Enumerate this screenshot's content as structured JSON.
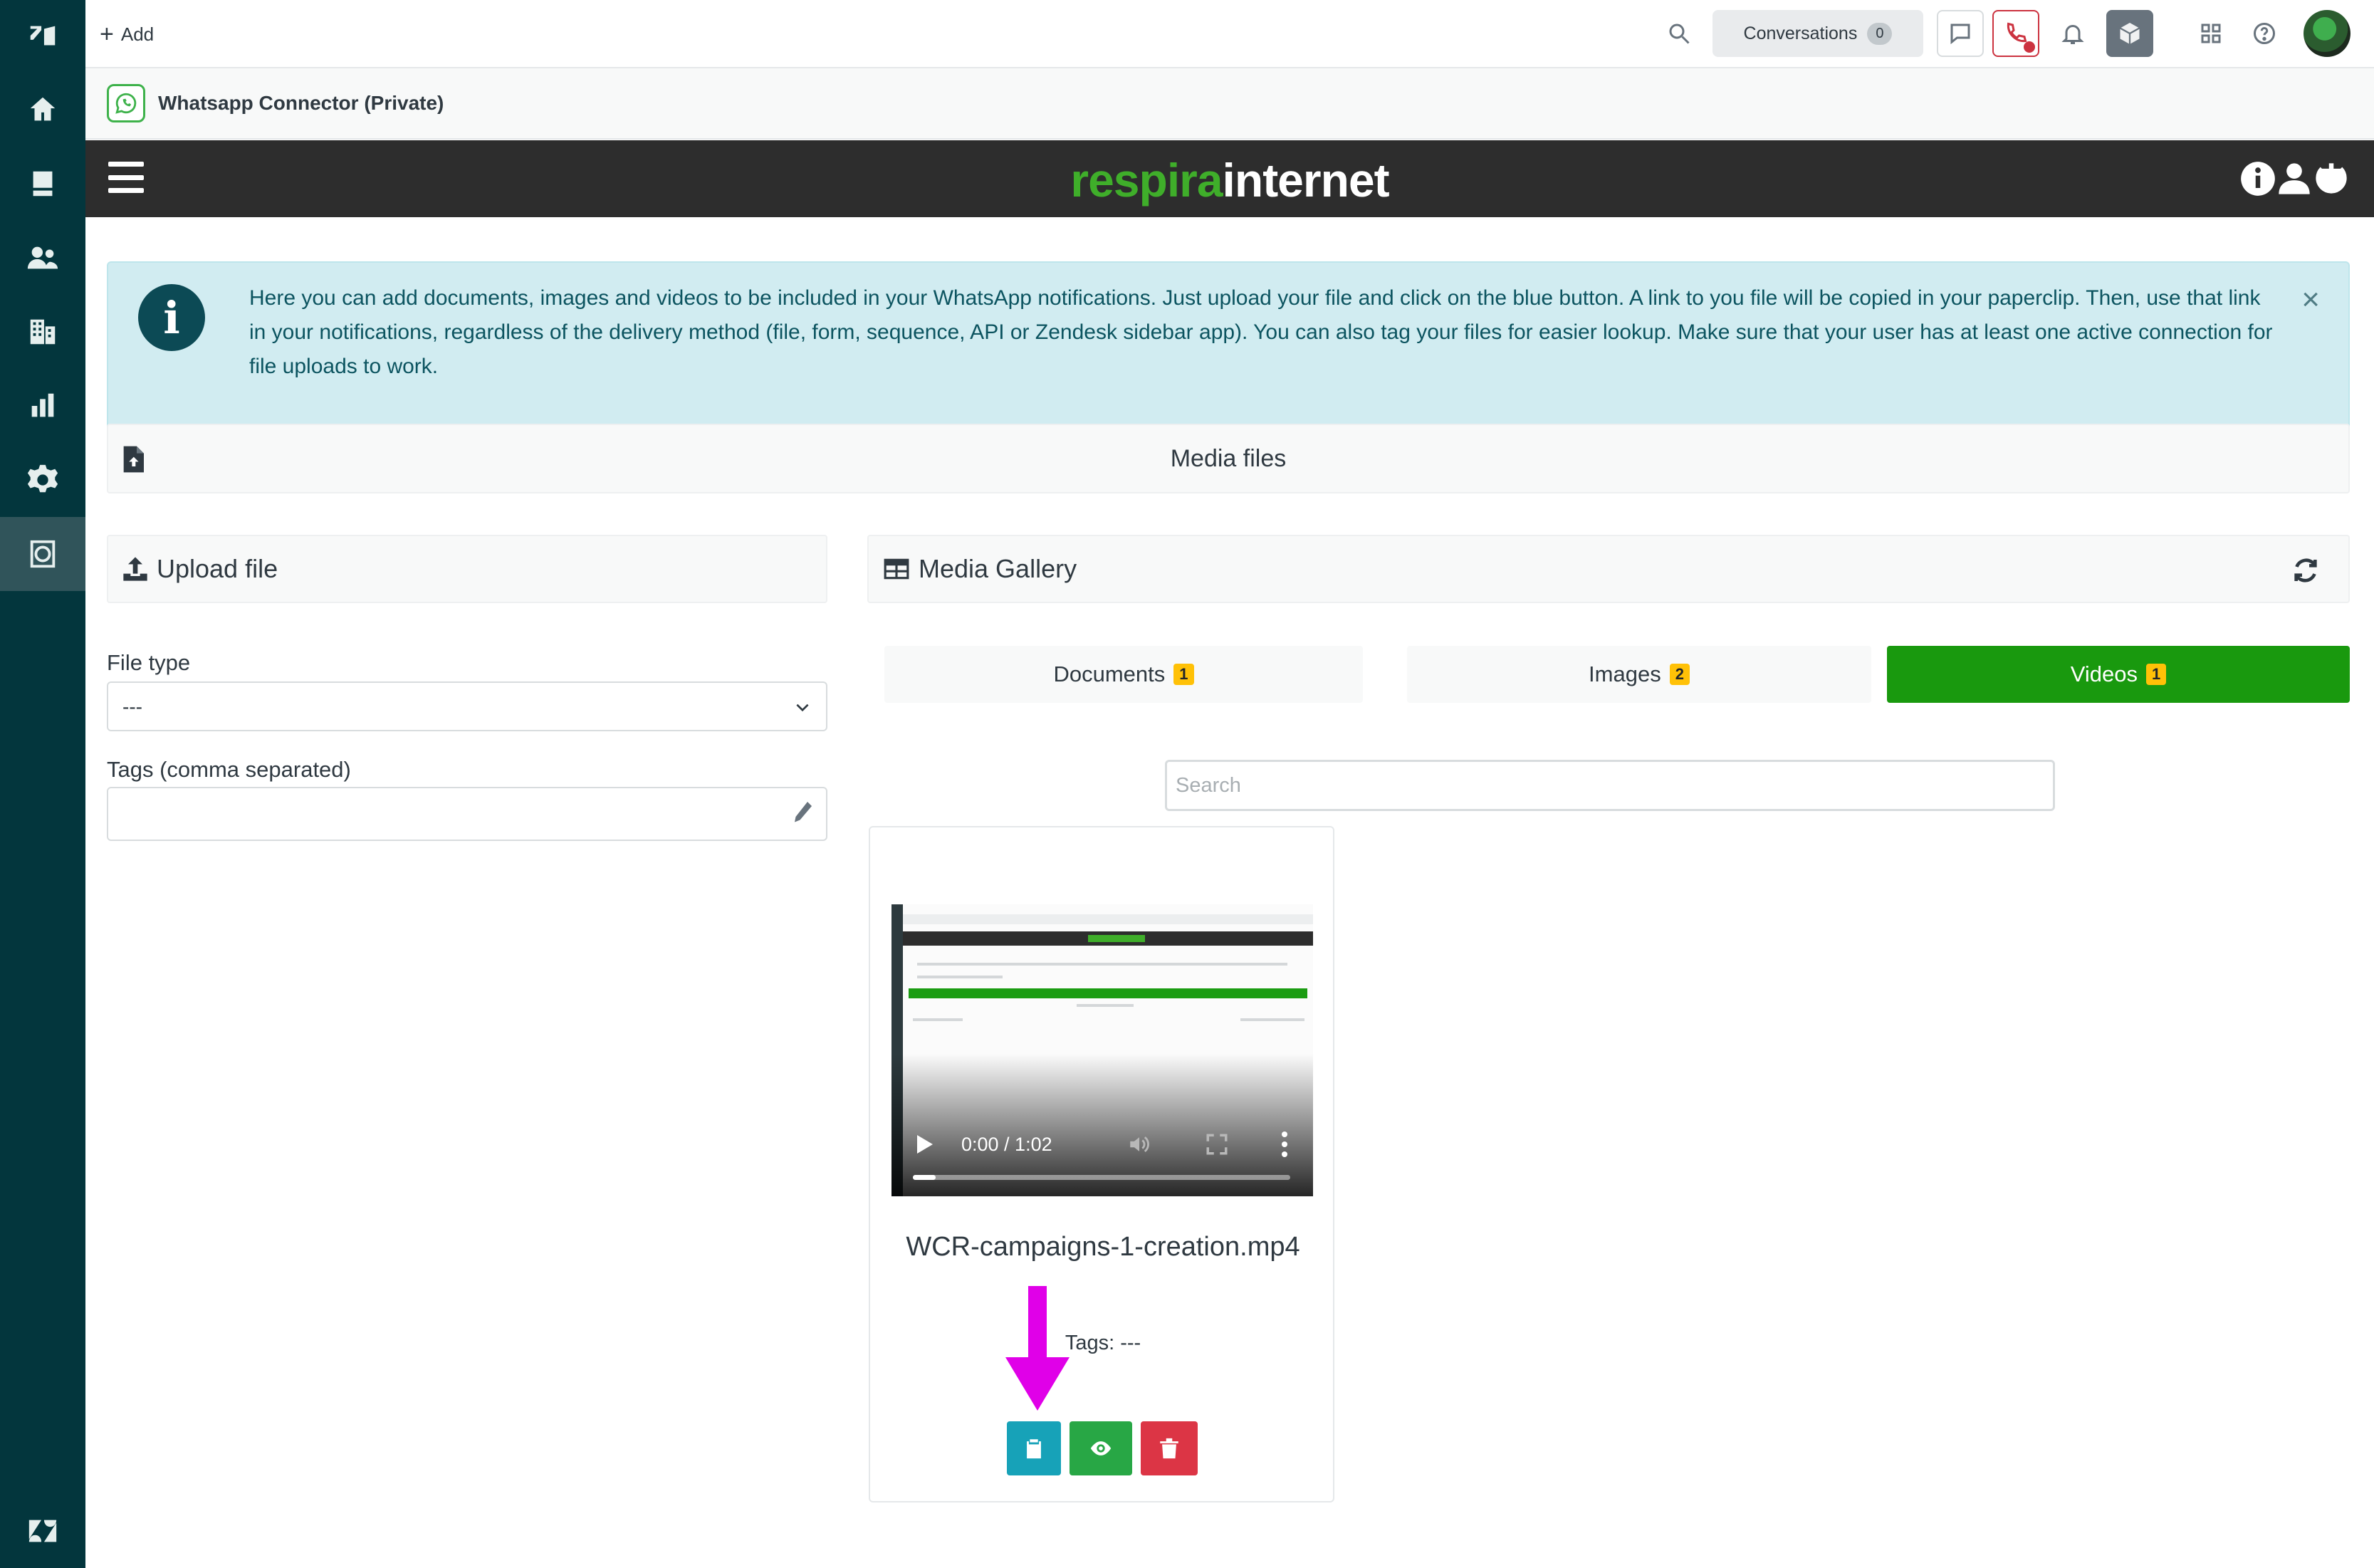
{
  "topbar": {
    "add_label": "Add",
    "conversations_label": "Conversations",
    "conversations_count": "0"
  },
  "leftnav": {
    "items": [
      "zendesk-logo",
      "home",
      "views",
      "customers",
      "organizations",
      "reporting",
      "admin",
      "whatsapp-app",
      "zendesk-mark"
    ]
  },
  "app": {
    "title": "Whatsapp Connector (Private)"
  },
  "brand": {
    "part1": "respira",
    "part2": "internet",
    "colors": {
      "green": "#3fae2a",
      "bar": "#2d2d2d"
    }
  },
  "alert": {
    "text": "Here you can add documents, images and videos to be included in your WhatsApp notifications. Just upload your file and click on the blue button. A link to you file will be copied in your paperclip. Then, use that link in your notifications, regardless of the delivery method (file, form, sequence, API or Zendesk sidebar app). You can also tag your files for easier lookup. Make sure that your user has at least one active connection for file uploads to work.",
    "close": "×"
  },
  "media_files": {
    "title": "Media files"
  },
  "upload": {
    "title": "Upload file",
    "file_type_label": "File type",
    "file_type_value": "---",
    "tags_label": "Tags (comma separated)",
    "tags_value": ""
  },
  "gallery": {
    "title": "Media Gallery",
    "tabs": [
      {
        "label": "Documents",
        "count": "1",
        "active": false
      },
      {
        "label": "Images",
        "count": "2",
        "active": false
      },
      {
        "label": "Videos",
        "count": "1",
        "active": true
      }
    ],
    "search_placeholder": "Search",
    "active_tab_color": "#19990e"
  },
  "video_card": {
    "filename": "WCR-campaigns-1-creation.mp4",
    "tags": "Tags: ---",
    "time": "0:00 / 1:02",
    "progress": 0.06,
    "buttons": {
      "copy_color": "#17a2b8",
      "preview_color": "#28a745",
      "delete_color": "#dc3545"
    }
  },
  "annotation": {
    "arrow_color": "#e000e8"
  }
}
